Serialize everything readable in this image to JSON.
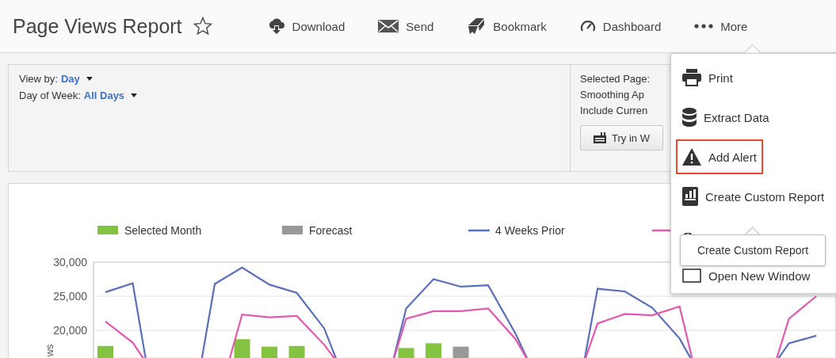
{
  "header": {
    "title": "Page Views Report",
    "favorite": false,
    "actions": [
      {
        "label": "Download"
      },
      {
        "label": "Send"
      },
      {
        "label": "Bookmark"
      },
      {
        "label": "Dashboard"
      },
      {
        "label": "More"
      }
    ]
  },
  "filters": [
    {
      "label": "View by:",
      "value": "Day"
    },
    {
      "label": "Day of Week:",
      "value": "All Days"
    }
  ],
  "settings": {
    "lines": [
      "Selected Page:",
      "Smoothing Ap",
      "Include Curren"
    ],
    "button": "Try in W"
  },
  "chart": {
    "chart_data": {
      "type": "bar",
      "stacked": false,
      "legend": "top",
      "ylim": [
        15900,
        30000
      ],
      "ylabel": "ws",
      "categories": [
        null,
        null,
        null,
        null,
        null,
        null,
        null,
        null,
        null,
        null,
        null,
        null,
        null,
        null,
        null,
        null,
        null,
        null,
        null,
        null,
        null,
        null,
        null,
        null,
        null,
        null,
        null
      ],
      "yticks": [
        {
          "value": 20000,
          "label": "20,000"
        },
        {
          "value": 25000,
          "label": "25,000"
        },
        {
          "value": 30000,
          "label": "30,000"
        }
      ],
      "series": [
        {
          "name": "Selected Month",
          "color": "#84c341",
          "values": [
            17700,
            null,
            null,
            null,
            null,
            18700,
            17600,
            17700,
            null,
            null,
            null,
            17400,
            18100,
            null,
            null,
            null,
            null,
            null,
            null,
            null,
            null,
            null,
            null,
            null,
            null,
            null,
            null
          ]
        },
        {
          "name": "Forecast",
          "color": "#999999",
          "values": [
            null,
            null,
            null,
            null,
            null,
            null,
            null,
            null,
            null,
            null,
            null,
            null,
            null,
            17600,
            null,
            null,
            null,
            null,
            null,
            null,
            null,
            null,
            null,
            null,
            null,
            null,
            null
          ]
        },
        {
          "name": "4 Weeks Prior",
          "color": "#5b6fb8",
          "type": "line",
          "values": [
            25600,
            26900,
            null,
            null,
            26800,
            29200,
            26700,
            25500,
            20300,
            null,
            null,
            23200,
            27500,
            26400,
            26600,
            19500,
            null,
            null,
            26100,
            25700,
            23300,
            18800,
            null,
            null,
            null,
            18100,
            19200
          ]
        },
        {
          "color": "#e05ab0",
          "type": "line",
          "values": [
            21300,
            18200,
            null,
            null,
            null,
            22300,
            21900,
            22100,
            17900,
            null,
            null,
            21700,
            22800,
            22800,
            23200,
            18700,
            null,
            null,
            21000,
            22400,
            22200,
            23500,
            null,
            null,
            null,
            21700,
            25000
          ]
        }
      ]
    }
  },
  "menu": {
    "items": [
      {
        "label": "Print",
        "selected": false
      },
      {
        "label": "Extract Data",
        "selected": false
      },
      {
        "label": "Add Alert",
        "selected": true
      },
      {
        "label": "Create Custom Report",
        "selected": false
      },
      {
        "selected": false
      },
      {
        "label": "Open New Window",
        "selected": false
      }
    ],
    "tooltip": "Create Custom Report"
  }
}
